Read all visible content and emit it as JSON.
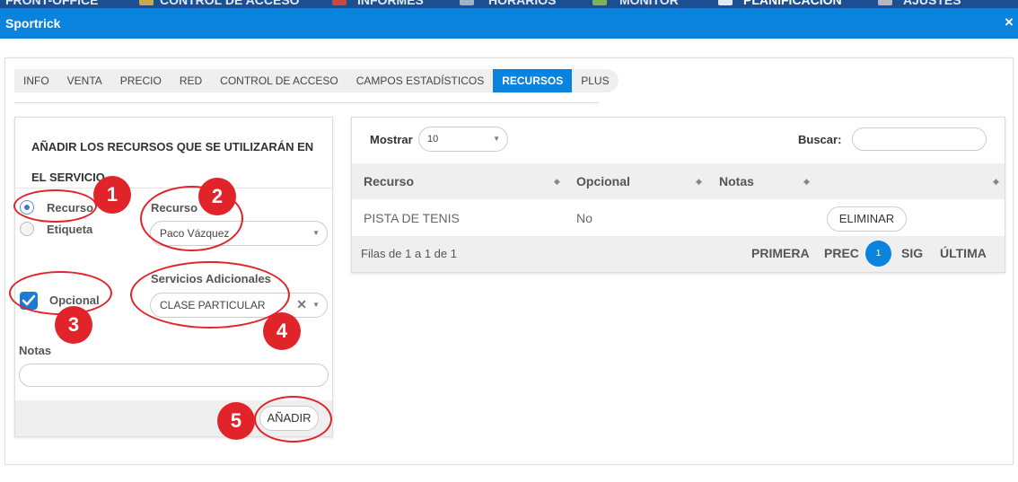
{
  "topnav": {
    "items": [
      "FRONT-OFFICE",
      "CONTROL DE ACCESO",
      "INFORMES",
      "HORARIOS",
      "MONITOR",
      "PLANIFICACIÓN",
      "AJUSTES"
    ]
  },
  "window": {
    "title": "Sportrick",
    "close_icon": "×"
  },
  "tabs": [
    {
      "label": "INFO",
      "active": false
    },
    {
      "label": "VENTA",
      "active": false
    },
    {
      "label": "PRECIO",
      "active": false
    },
    {
      "label": "RED",
      "active": false
    },
    {
      "label": "CONTROL DE ACCESO",
      "active": false
    },
    {
      "label": "CAMPOS ESTADÍSTICOS",
      "active": false
    },
    {
      "label": "RECURSOS",
      "active": true
    },
    {
      "label": "PLUS",
      "active": false
    }
  ],
  "form": {
    "heading": "AÑADIR LOS RECURSOS QUE SE UTILIZARÁN EN EL SERVICIO",
    "type_options": [
      {
        "label": "Recurso",
        "checked": true
      },
      {
        "label": "Etiqueta",
        "checked": false
      }
    ],
    "recurso_label": "Recurso",
    "recurso_value": "Paco Vázquez",
    "opcional_label": "Opcional",
    "opcional_checked": true,
    "servicios_label": "Servicios Adicionales",
    "servicios_value": "CLASE PARTICULAR",
    "notas_label": "Notas",
    "notas_value": "",
    "add_button": "AÑADIR"
  },
  "table": {
    "show_label": "Mostrar",
    "page_size": "10",
    "search_label": "Buscar:",
    "search_value": "",
    "columns": [
      "Recurso",
      "Opcional",
      "Notas",
      ""
    ],
    "rows": [
      {
        "recurso": "PISTA DE TENIS",
        "opcional": "No",
        "notas": "",
        "action": "ELIMINAR"
      }
    ],
    "info": "Filas de 1 a 1 de 1",
    "pagination": {
      "first": "PRIMERA",
      "prev": "PREC",
      "current": "1",
      "next": "SIG",
      "last": "ÚLTIMA"
    }
  },
  "annotations": [
    "1",
    "2",
    "3",
    "4",
    "5"
  ],
  "colors": {
    "primary": "#0a83de",
    "annotation_red": "#e0242a",
    "checkbox_blue": "#1c7ad4"
  }
}
